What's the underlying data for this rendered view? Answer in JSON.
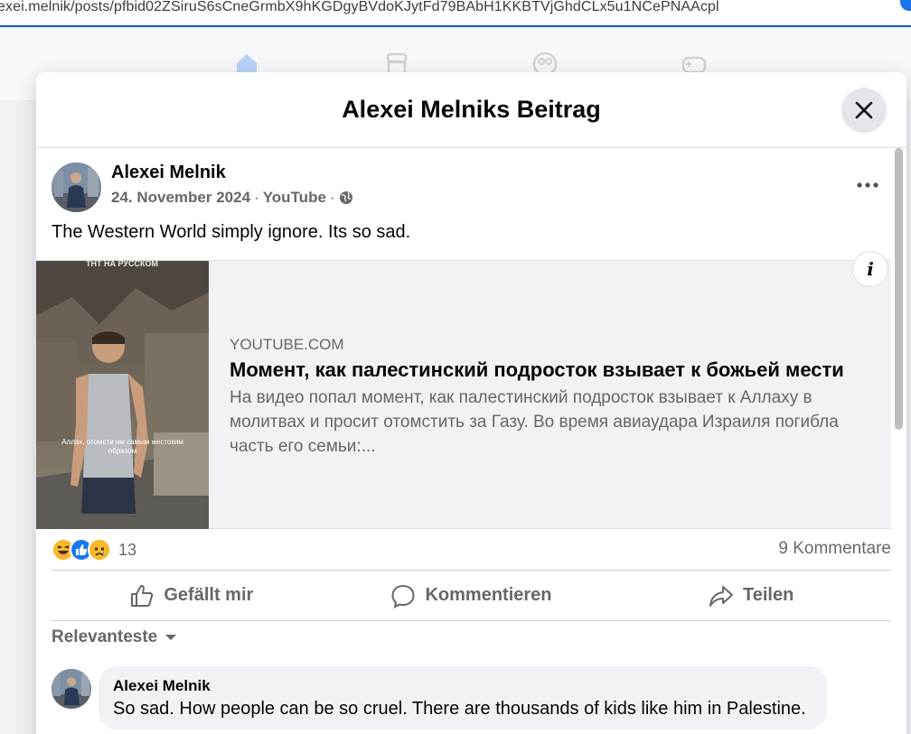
{
  "browser": {
    "url": "exei.melnik/posts/pfbid02ZSiruS6sCneGrmbX9hKGDgyBVdoKJytFd79BAbH1KKBTVjGhdCLx5u1NCePNAAcpl"
  },
  "background_nav": {
    "icons": [
      "home-icon",
      "marketplace-icon",
      "groups-icon",
      "gaming-icon"
    ]
  },
  "modal": {
    "title": "Alexei Melniks Beitrag",
    "close_icon": "close-icon"
  },
  "post": {
    "author": "Alexei Melnik",
    "date": "24. November 2024",
    "separator": "·",
    "source": "YouTube",
    "audience_icon": "globe-icon",
    "text": "The Western World simply ignore. Its so sad."
  },
  "link_preview": {
    "overlay_top_text": "ТНТ НА РУССКОМ",
    "overlay_caption": "Аллах, отомсти им самым жестоким образом",
    "info_label": "i",
    "domain": "YOUTUBE.COM",
    "title": "Момент, как палестинский подросток взывает к божьей мести",
    "description": "На видео попал момент, как палестинский подросток взывает к Аллаху в молитвах и просит отомстить за Газу. Во время авиаудара Израиля погибла часть его семьи:..."
  },
  "stats": {
    "reactions": [
      "haha-icon",
      "like-icon",
      "sad-icon"
    ],
    "reaction_count": "13",
    "comments": "9 Kommentare"
  },
  "actions": {
    "like": "Gefällt mir",
    "comment": "Kommentieren",
    "share": "Teilen"
  },
  "comments_section": {
    "sort_label": "Relevanteste",
    "items": [
      {
        "author": "Alexei Melnik",
        "text": "So sad. How people can be so cruel. There are thousands of kids like him in Palestine."
      }
    ]
  },
  "colors": {
    "accent": "#0866ff",
    "secondary_text": "#65676b",
    "card_bg": "#f0f2f5",
    "divider": "#ced0d4"
  }
}
